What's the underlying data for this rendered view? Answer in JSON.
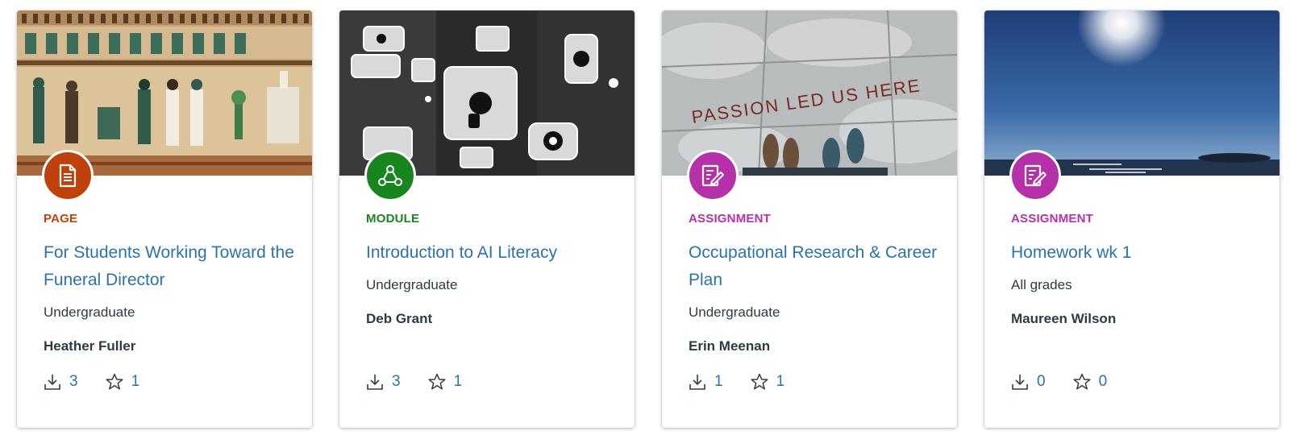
{
  "colors": {
    "page": "#c0410b",
    "module": "#17861f",
    "assignment": "#b530a9",
    "link": "#2b73aa",
    "text": "#2d3b45"
  },
  "cards": [
    {
      "type": "PAGE",
      "type_icon": "document-icon",
      "type_color": "#c0410b",
      "thumbnail": "egyptian-papyrus-image",
      "title": "For Students Working Toward the Funeral Director",
      "audience": "Undergraduate",
      "author": "Heather Fuller",
      "downloads": "3",
      "favorites": "1"
    },
    {
      "type": "MODULE",
      "type_icon": "module-icon",
      "type_color": "#17861f",
      "thumbnail": "tech-icons-image",
      "title": "Introduction to AI Literacy",
      "audience": "Undergraduate",
      "author": "Deb Grant",
      "downloads": "3",
      "favorites": "1"
    },
    {
      "type": "ASSIGNMENT",
      "type_icon": "assignment-icon",
      "type_color": "#b530a9",
      "thumbnail": "passion-led-us-here-image",
      "thumbnail_text": "PASSION LED US HERE",
      "title": "Occupational Research & Career Plan",
      "audience": "Undergraduate",
      "author": "Erin Meenan",
      "downloads": "1",
      "favorites": "1"
    },
    {
      "type": "ASSIGNMENT",
      "type_icon": "assignment-icon",
      "type_color": "#b530a9",
      "thumbnail": "sun-over-sea-image",
      "title": "Homework wk 1",
      "audience": "All grades",
      "author": "Maureen Wilson",
      "downloads": "0",
      "favorites": "0"
    }
  ]
}
